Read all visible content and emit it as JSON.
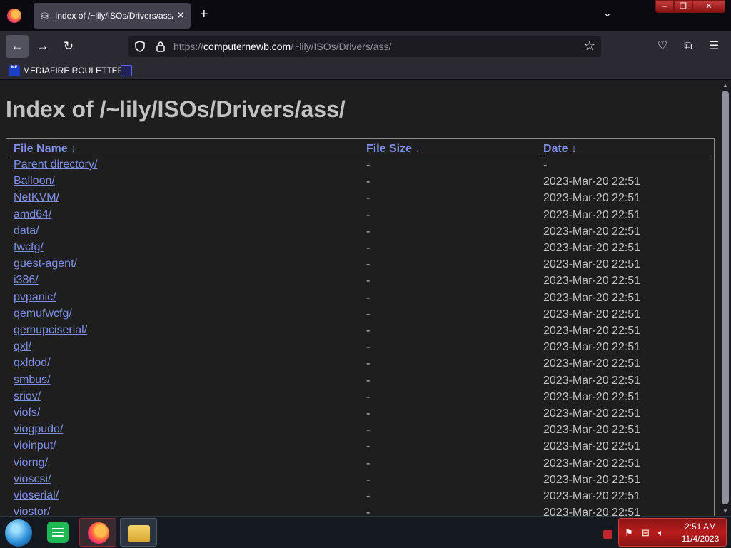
{
  "browser": {
    "tab_title": "Index of /~lily/ISOs/Drivers/ass/",
    "new_tab_symbol": "+",
    "url_scheme": "https://",
    "url_host": "computernewb.com",
    "url_path": "/~lily/ISOs/Drivers/ass/"
  },
  "bookmarks": [
    {
      "label": "MEDIAFIRE ROULETTER",
      "icon": "mediafire-icon",
      "icon_text": "MF"
    },
    {
      "label": "",
      "icon": "sigma-icon"
    }
  ],
  "page": {
    "heading": "Index of /~lily/ISOs/Drivers/ass/",
    "columns": [
      {
        "label": "File Name",
        "sort": "↓"
      },
      {
        "label": "File Size",
        "sort": "↓"
      },
      {
        "label": "Date",
        "sort": "↓"
      }
    ],
    "rows": [
      {
        "name": "Parent directory/",
        "size": "-",
        "date": "-"
      },
      {
        "name": "Balloon/",
        "size": "-",
        "date": "2023-Mar-20 22:51"
      },
      {
        "name": "NetKVM/",
        "size": "-",
        "date": "2023-Mar-20 22:51"
      },
      {
        "name": "amd64/",
        "size": "-",
        "date": "2023-Mar-20 22:51"
      },
      {
        "name": "data/",
        "size": "-",
        "date": "2023-Mar-20 22:51"
      },
      {
        "name": "fwcfg/",
        "size": "-",
        "date": "2023-Mar-20 22:51"
      },
      {
        "name": "guest-agent/",
        "size": "-",
        "date": "2023-Mar-20 22:51"
      },
      {
        "name": "i386/",
        "size": "-",
        "date": "2023-Mar-20 22:51"
      },
      {
        "name": "pvpanic/",
        "size": "-",
        "date": "2023-Mar-20 22:51"
      },
      {
        "name": "qemufwcfg/",
        "size": "-",
        "date": "2023-Mar-20 22:51"
      },
      {
        "name": "qemupciserial/",
        "size": "-",
        "date": "2023-Mar-20 22:51"
      },
      {
        "name": "qxl/",
        "size": "-",
        "date": "2023-Mar-20 22:51"
      },
      {
        "name": "qxldod/",
        "size": "-",
        "date": "2023-Mar-20 22:51"
      },
      {
        "name": "smbus/",
        "size": "-",
        "date": "2023-Mar-20 22:51"
      },
      {
        "name": "sriov/",
        "size": "-",
        "date": "2023-Mar-20 22:51"
      },
      {
        "name": "viofs/",
        "size": "-",
        "date": "2023-Mar-20 22:51"
      },
      {
        "name": "viogpudo/",
        "size": "-",
        "date": "2023-Mar-20 22:51"
      },
      {
        "name": "vioinput/",
        "size": "-",
        "date": "2023-Mar-20 22:51"
      },
      {
        "name": "viorng/",
        "size": "-",
        "date": "2023-Mar-20 22:51"
      },
      {
        "name": "vioscsi/",
        "size": "-",
        "date": "2023-Mar-20 22:51"
      },
      {
        "name": "vioserial/",
        "size": "-",
        "date": "2023-Mar-20 22:51"
      },
      {
        "name": "viostor/",
        "size": "-",
        "date": "2023-Mar-20 22:51"
      }
    ]
  },
  "taskbar": {
    "time": "2:51 AM",
    "date": "11/4/2023"
  },
  "colors": {
    "link": "#7f8fe3",
    "page_bg": "#1e1e1f",
    "text": "#c2c2c2",
    "tray_accent": "#b81c1c"
  }
}
